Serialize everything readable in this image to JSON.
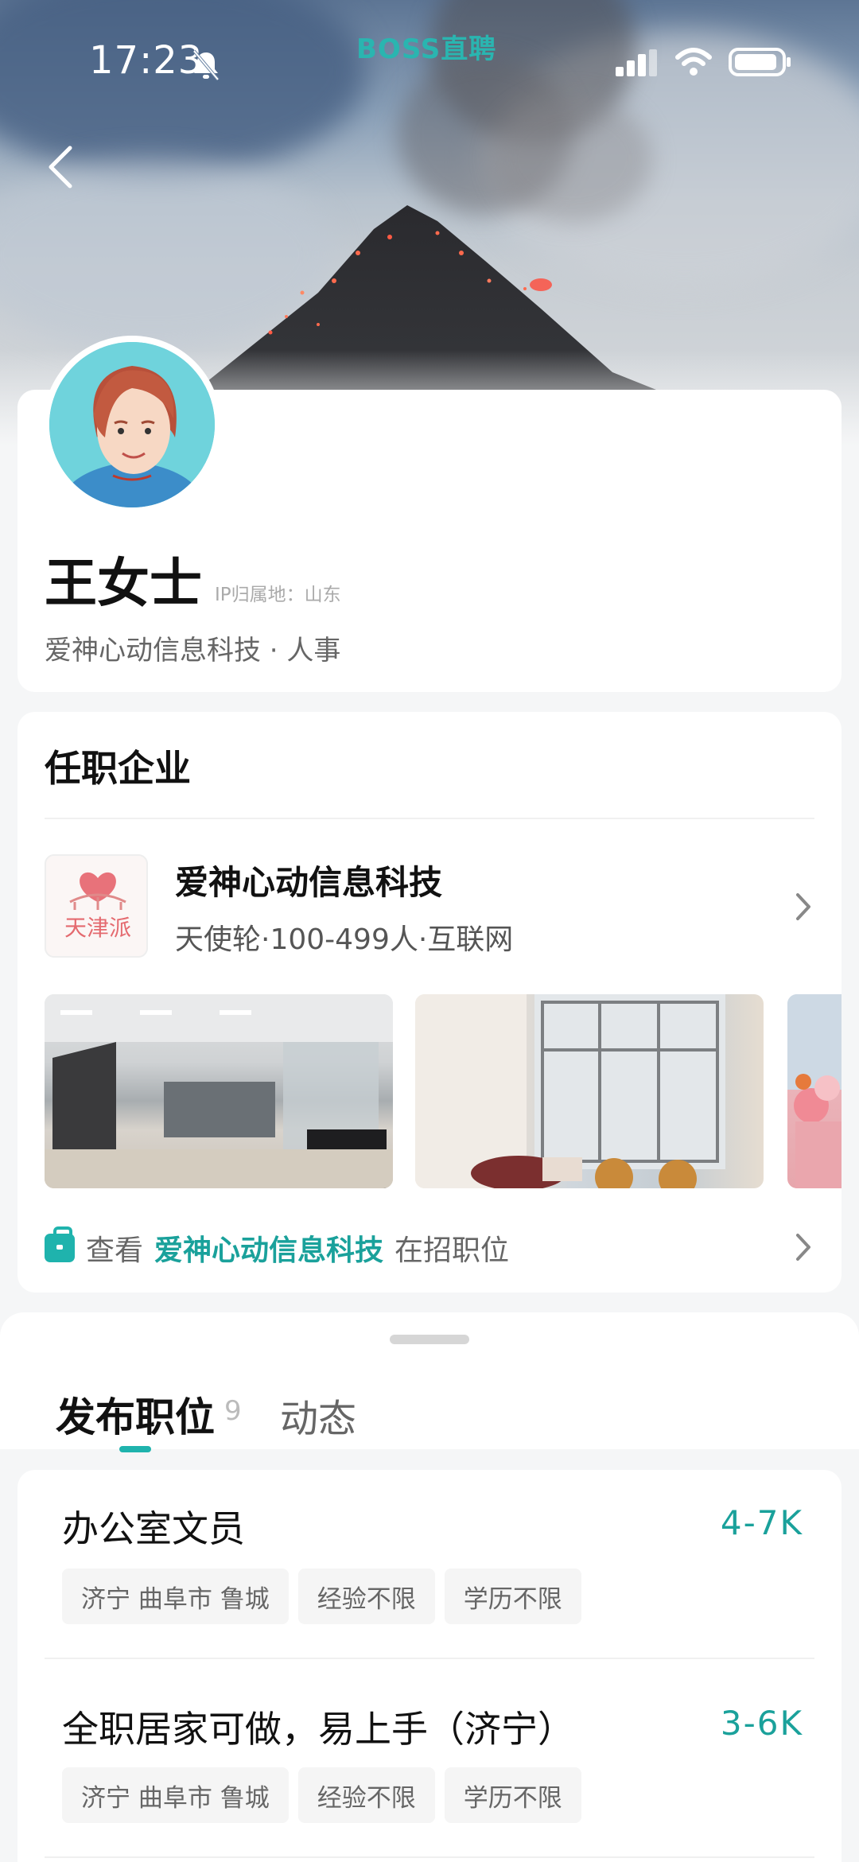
{
  "status_bar": {
    "time": "17:23",
    "brand": "BOSS直聘"
  },
  "profile": {
    "name": "王女士",
    "ip_location": "IP归属地：山东",
    "role": "爱神心动信息科技 · 人事"
  },
  "company_section": {
    "title": "任职企业",
    "logo_text": "天津派",
    "company_name": "爱神心动信息科技",
    "company_meta": "天使轮·100-499人·互联网",
    "jobs_link": {
      "prefix": "查看",
      "company": "爱神心动信息科技",
      "suffix": "在招职位"
    }
  },
  "tabs": [
    {
      "label": "发布职位",
      "count": "9",
      "active": true
    },
    {
      "label": "动态",
      "active": false
    }
  ],
  "jobs": [
    {
      "title": "办公室文员",
      "salary": "4-7K",
      "tags": [
        "济宁 曲阜市 鲁城",
        "经验不限",
        "学历不限"
      ]
    },
    {
      "title": "全职居家可做，易上手（济宁）",
      "salary": "3-6K",
      "tags": [
        "济宁 曲阜市 鲁城",
        "经验不限",
        "学历不限"
      ]
    }
  ],
  "colors": {
    "accent": "#1aa19b",
    "brand": "#2ab5b0"
  },
  "icons": [
    "back-arrow-icon",
    "bell-mute-icon",
    "signal-icon",
    "wifi-icon",
    "battery-icon",
    "chevron-right-icon",
    "briefcase-icon"
  ]
}
